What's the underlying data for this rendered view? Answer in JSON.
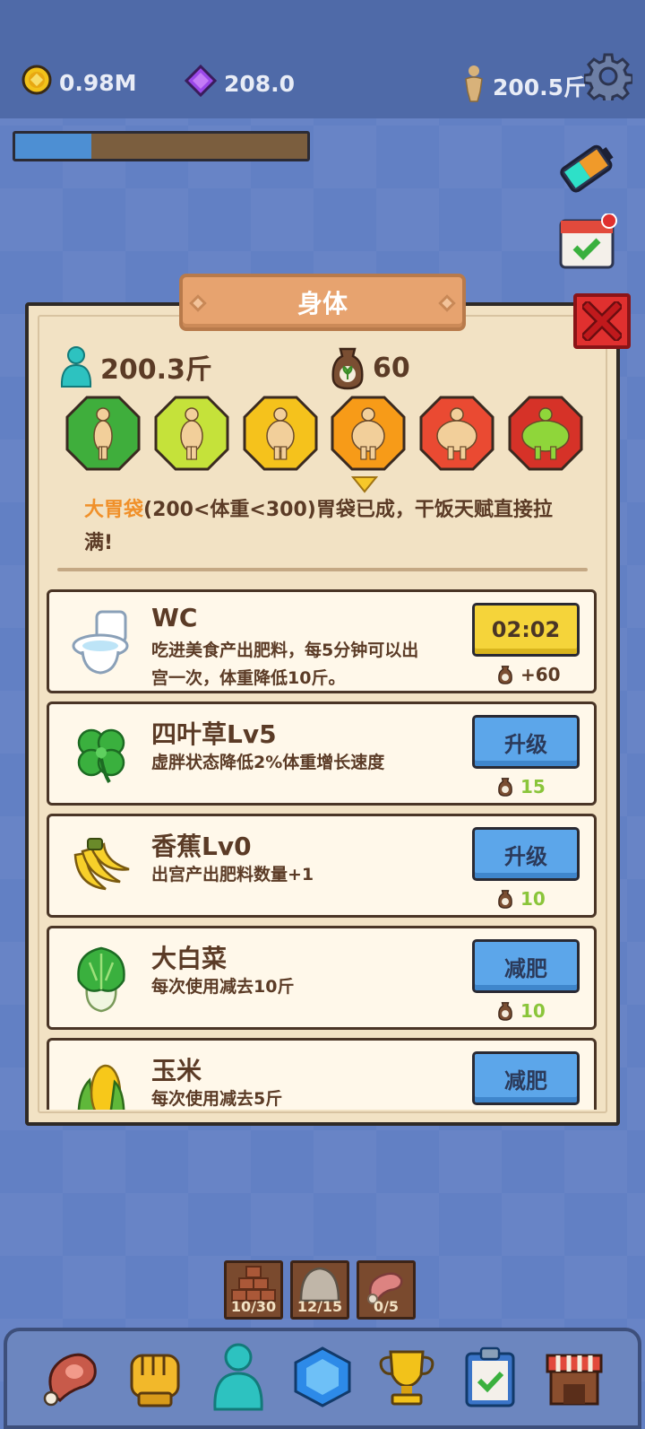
{
  "topbar": {
    "coins": "0.98M",
    "gems": "208.0",
    "weight": "200.5斤",
    "progress_fraction": 0.26
  },
  "panel": {
    "title": "身体",
    "current_weight": "200.3斤",
    "fertilizer": "60",
    "body_levels": [
      {
        "color": "#3fae3c"
      },
      {
        "color": "#c5e23a"
      },
      {
        "color": "#f5c21c"
      },
      {
        "color": "#f79b18"
      },
      {
        "color": "#ea4a32"
      },
      {
        "color": "#d63228"
      }
    ],
    "description_highlight": "大胃袋",
    "description_text": "(200<体重<300)胃袋已成，干饭天赋直接拉满!"
  },
  "items": [
    {
      "name": "WC",
      "desc": "吃进美食产出肥料，每5分钟可以出宫一次，体重降低10斤。",
      "button": "02:02",
      "button_style": "yellow",
      "cost": "+60",
      "cost_style": "dark",
      "icon": "toilet-icon"
    },
    {
      "name": "四叶草Lv5",
      "desc": "虚胖状态降低2%体重增长速度",
      "button": "升级",
      "button_style": "blue",
      "cost": "15",
      "cost_style": "green",
      "icon": "clover-icon"
    },
    {
      "name": "香蕉Lv0",
      "desc": "出宫产出肥料数量+1",
      "button": "升级",
      "button_style": "blue",
      "cost": "10",
      "cost_style": "green",
      "icon": "banana-icon"
    },
    {
      "name": "大白菜",
      "desc": "每次使用减去10斤",
      "button": "减肥",
      "button_style": "blue",
      "cost": "10",
      "cost_style": "green",
      "icon": "cabbage-icon"
    },
    {
      "name": "玉米",
      "desc": "每次使用减去5斤",
      "button": "减肥",
      "button_style": "blue",
      "cost": "",
      "cost_style": "green",
      "icon": "corn-icon"
    }
  ],
  "slots": [
    {
      "label": "10/30",
      "icon": "bricks-icon"
    },
    {
      "label": "12/15",
      "icon": "stone-icon"
    },
    {
      "label": "0/5",
      "icon": "meat-leg-icon"
    }
  ],
  "nav": [
    "meat-icon",
    "fist-icon",
    "body-icon",
    "gem-icon",
    "trophy-icon",
    "clipboard-icon",
    "shop-icon"
  ]
}
